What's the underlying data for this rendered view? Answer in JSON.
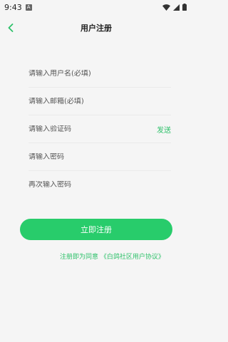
{
  "status": {
    "time": "9:43",
    "notification_letter": "A"
  },
  "header": {
    "title": "用户注册"
  },
  "form": {
    "username_placeholder": "请输入用户名(必填)",
    "email_placeholder": "请输入邮箱(必填)",
    "code_placeholder": "请输入验证码",
    "send_label": "发送",
    "password_placeholder": "请输入密码",
    "confirm_placeholder": "再次输入密码"
  },
  "submit_label": "立即注册",
  "agreement_text": "注册即为同意 《白鸽社区用户协议》",
  "colors": {
    "accent": "#28cc6b",
    "link": "#2ec16a",
    "background": "#f5f5f5"
  }
}
